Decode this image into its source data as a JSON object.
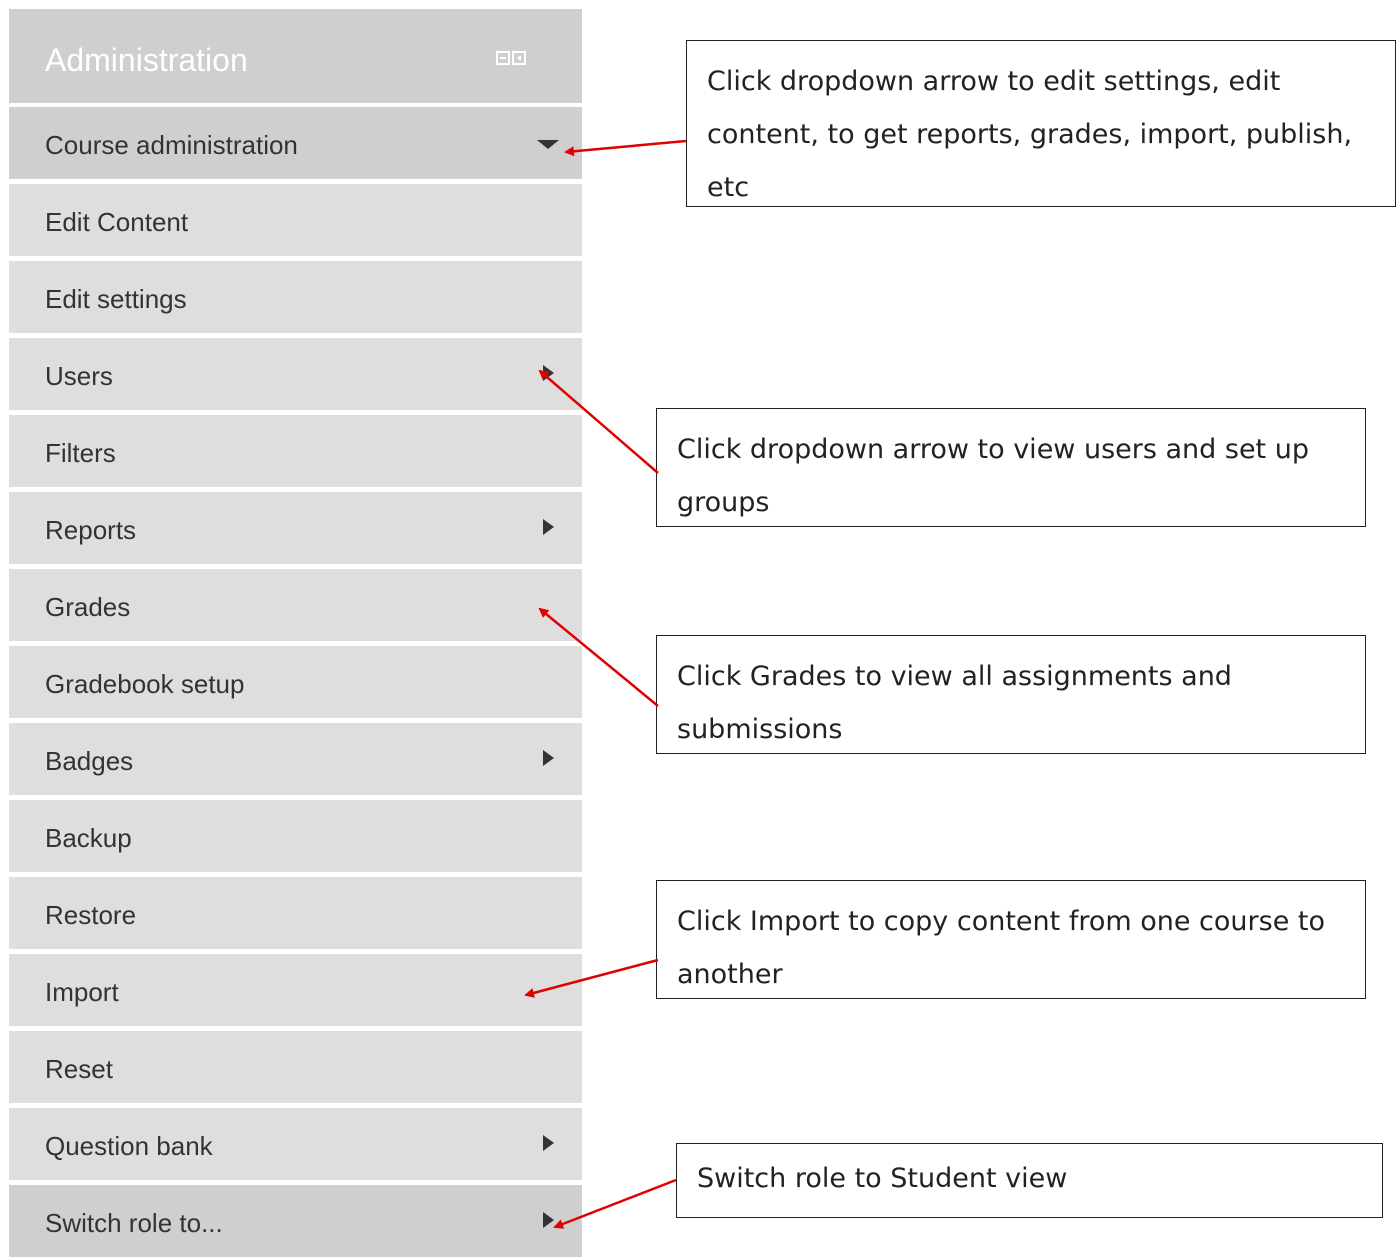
{
  "block": {
    "title": "Administration",
    "header_icons": [
      "minimize-icon",
      "dock-icon"
    ]
  },
  "menu": {
    "items": [
      {
        "label": "Course administration",
        "arrow": "down"
      },
      {
        "label": "Edit Content",
        "arrow": ""
      },
      {
        "label": "Edit settings",
        "arrow": ""
      },
      {
        "label": "Users",
        "arrow": "right"
      },
      {
        "label": "Filters",
        "arrow": ""
      },
      {
        "label": "Reports",
        "arrow": "right"
      },
      {
        "label": "Grades",
        "arrow": ""
      },
      {
        "label": "Gradebook setup",
        "arrow": ""
      },
      {
        "label": "Badges",
        "arrow": "right"
      },
      {
        "label": "Backup",
        "arrow": ""
      },
      {
        "label": "Restore",
        "arrow": ""
      },
      {
        "label": "Import",
        "arrow": ""
      },
      {
        "label": "Reset",
        "arrow": ""
      },
      {
        "label": "Question bank",
        "arrow": "right"
      },
      {
        "label": "Switch role to...",
        "arrow": "right"
      }
    ]
  },
  "callouts": [
    {
      "text": "Click dropdown arrow to edit settings, edit content, to get reports, grades, import, publish, etc"
    },
    {
      "text": "Click dropdown arrow to view users and set up groups"
    },
    {
      "text": "Click Grades to view all assignments and submissions"
    },
    {
      "text": "Click Import to copy content from one course to another"
    },
    {
      "text": "Switch role to Student view"
    }
  ],
  "colors": {
    "header_bg": "#cfcfcf",
    "row_bg": "#dedede",
    "row_text": "#333333",
    "annotation_arrow": "#e00000"
  }
}
